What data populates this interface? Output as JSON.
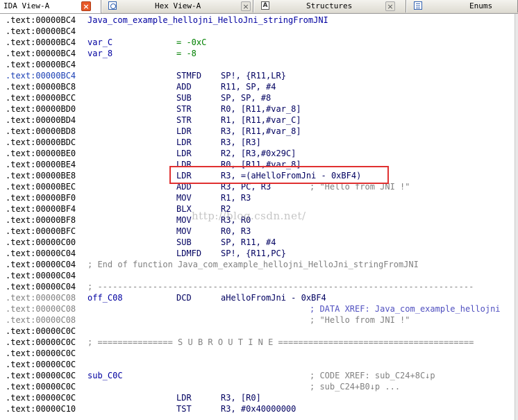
{
  "tabs": [
    {
      "label": "IDA View-A",
      "active": true,
      "icon": "none"
    },
    {
      "label": "Hex View-A",
      "active": false,
      "icon": "hex-view-icon"
    },
    {
      "label": "Structures",
      "active": false,
      "icon": "structures-icon"
    },
    {
      "label": "Enums",
      "active": false,
      "icon": "enums-icon"
    }
  ],
  "tab_icons": {
    "structures_glyph": "A"
  },
  "listing": {
    "lines": [
      {
        "addr": ".text:00000BC4",
        "name": "Java_com_example_hellojni_HelloJni_stringFromJNI"
      },
      {
        "addr": ".text:00000BC4"
      },
      {
        "addr": ".text:00000BC4",
        "name": "var_C",
        "mnem": "= -0xC"
      },
      {
        "addr": ".text:00000BC4",
        "name": "var_8",
        "mnem": "= -8"
      },
      {
        "addr": ".text:00000BC4"
      },
      {
        "addr": ".text:00000BC4",
        "mnem": "STMFD",
        "ops": "SP!, {R11,LR}",
        "addr_style": "hl"
      },
      {
        "addr": ".text:00000BC8",
        "mnem": "ADD",
        "ops": "R11, SP, #4"
      },
      {
        "addr": ".text:00000BCC",
        "mnem": "SUB",
        "ops": "SP, SP, #8"
      },
      {
        "addr": ".text:00000BD0",
        "mnem": "STR",
        "ops": "R0, [R11,#var_8]"
      },
      {
        "addr": ".text:00000BD4",
        "mnem": "STR",
        "ops": "R1, [R11,#var_C]"
      },
      {
        "addr": ".text:00000BD8",
        "mnem": "LDR",
        "ops": "R3, [R11,#var_8]"
      },
      {
        "addr": ".text:00000BDC",
        "mnem": "LDR",
        "ops": "R3, [R3]"
      },
      {
        "addr": ".text:00000BE0",
        "mnem": "LDR",
        "ops": "R2, [R3,#0x29C]"
      },
      {
        "addr": ".text:00000BE4",
        "mnem": "LDR",
        "ops": "R0, [R11,#var_8]"
      },
      {
        "addr": ".text:00000BE8",
        "mnem": "LDR",
        "ops": "R3, =(aHelloFromJni - 0xBF4)"
      },
      {
        "addr": ".text:00000BEC",
        "mnem": "ADD",
        "ops": "R3, PC, R3",
        "comment": "; \"Hello from JNI !\""
      },
      {
        "addr": ".text:00000BF0",
        "mnem": "MOV",
        "ops": "R1, R3"
      },
      {
        "addr": ".text:00000BF4",
        "mnem": "BLX",
        "ops": "R2"
      },
      {
        "addr": ".text:00000BF8",
        "mnem": "MOV",
        "ops": "R3, R0"
      },
      {
        "addr": ".text:00000BFC",
        "mnem": "MOV",
        "ops": "R0, R3"
      },
      {
        "addr": ".text:00000C00",
        "mnem": "SUB",
        "ops": "SP, R11, #4"
      },
      {
        "addr": ".text:00000C04",
        "mnem": "LDMFD",
        "ops": "SP!, {R11,PC}"
      },
      {
        "addr": ".text:00000C04",
        "comment": "; End of function Java_com_example_hellojni_HelloJni_stringFromJNI",
        "comment_col": "name"
      },
      {
        "addr": ".text:00000C04"
      },
      {
        "addr": ".text:00000C04",
        "comment": "; ---------------------------------------------------------------------------",
        "comment_col": "name"
      },
      {
        "addr": ".text:00000C08",
        "name": "off_C08",
        "mnem": "DCD",
        "ops": "aHelloFromJni - 0xBF4",
        "addr_style": "gray"
      },
      {
        "addr": ".text:00000C08",
        "comment": "; DATA XREF: Java_com_example_hellojni",
        "comment_style": "xref",
        "addr_style": "gray"
      },
      {
        "addr": ".text:00000C08",
        "comment": "; \"Hello from JNI !\"",
        "addr_style": "gray"
      },
      {
        "addr": ".text:00000C0C"
      },
      {
        "addr": ".text:00000C0C",
        "comment": "; =============== S U B R O U T I N E =======================================",
        "comment_col": "name"
      },
      {
        "addr": ".text:00000C0C"
      },
      {
        "addr": ".text:00000C0C"
      },
      {
        "addr": ".text:00000C0C",
        "name": "sub_C0C",
        "comment": "; CODE XREF: sub_C24+8C↓p"
      },
      {
        "addr": ".text:00000C0C",
        "comment": "; sub_C24+B0↓p ..."
      },
      {
        "addr": ".text:00000C0C",
        "mnem": "LDR",
        "ops": "R3, [R0]"
      },
      {
        "addr": ".text:00000C10",
        "mnem": "TST",
        "ops": "R3, #0x40000000"
      }
    ]
  },
  "watermark": "http://blog.csdn.net/",
  "colors": {
    "highlight_box": "#e03030",
    "active_close": "#e85a2a",
    "name": "#0000a0",
    "number": "#008000",
    "comment": "#808080",
    "xref": "#5050c0"
  }
}
